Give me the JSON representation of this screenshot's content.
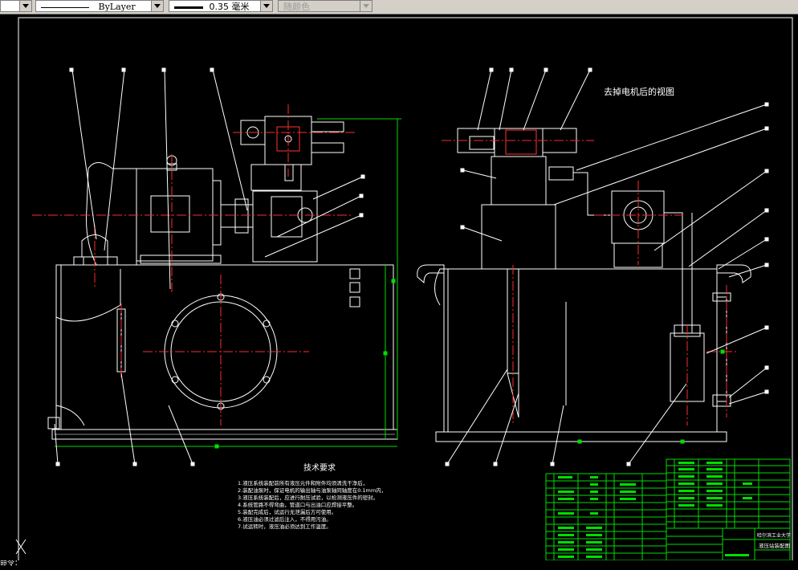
{
  "toolbar": {
    "linetype_label": "ByLayer",
    "lineweight_label": "0.35 毫米",
    "color_label": "随颜色"
  },
  "drawing": {
    "view_caption": "去掉电机后的视图",
    "tech_title": "技术要求",
    "tech_notes": [
      "1.液压系统装配前所有液压元件和附件均须清洗干净后，",
      "2.装配油泵时，保证电机的输出轴与油泵轴同轴度在0.1mm内，",
      "3.液压系统装配后，应进行耐压试验，以检测液压件的密封。",
      "4.系统管路不得弯曲，管道口与出油口应焊接平整。",
      "5.装配完成后，试运行无泄漏后方可使用。",
      "6.液压油必须过滤后注入，不得用污油。",
      "7.试运转时，液压油必须达到工作温度。"
    ],
    "title_block": {
      "company": "哈尔滨工业大学",
      "drawing_name": "液压站装配图"
    }
  },
  "colors": {
    "background": "#000000",
    "outline": "#ffffff",
    "centerline": "#ff0000",
    "table": "#00ff00",
    "dimension": "#00ff00",
    "text": "#ffffff"
  },
  "command_line": "命令："
}
